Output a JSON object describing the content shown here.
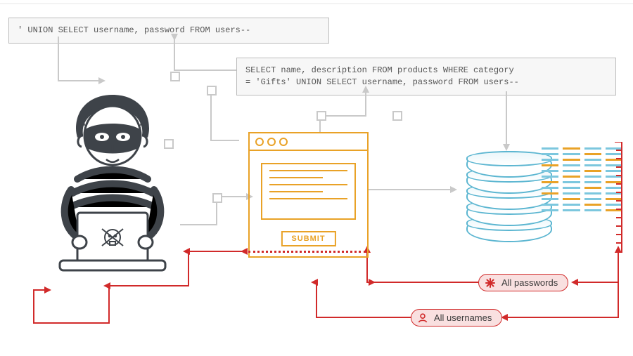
{
  "domain": "Diagram",
  "injection_payload": "' UNION SELECT username, password FROM users--",
  "resulting_query": "SELECT name, description FROM products WHERE category\n= 'Gifts' UNION SELECT username, password FROM users--",
  "form": {
    "submit_label": "SUBMIT"
  },
  "exfil": {
    "passwords_label": "All passwords",
    "usernames_label": "All usernames"
  },
  "colors": {
    "grey": "#c9c9c9",
    "accent": "#e9a227",
    "danger": "#d12a2a",
    "db": "#5cb6d1",
    "box_bg": "#f7f7f7",
    "box_border": "#bcbcbc"
  }
}
